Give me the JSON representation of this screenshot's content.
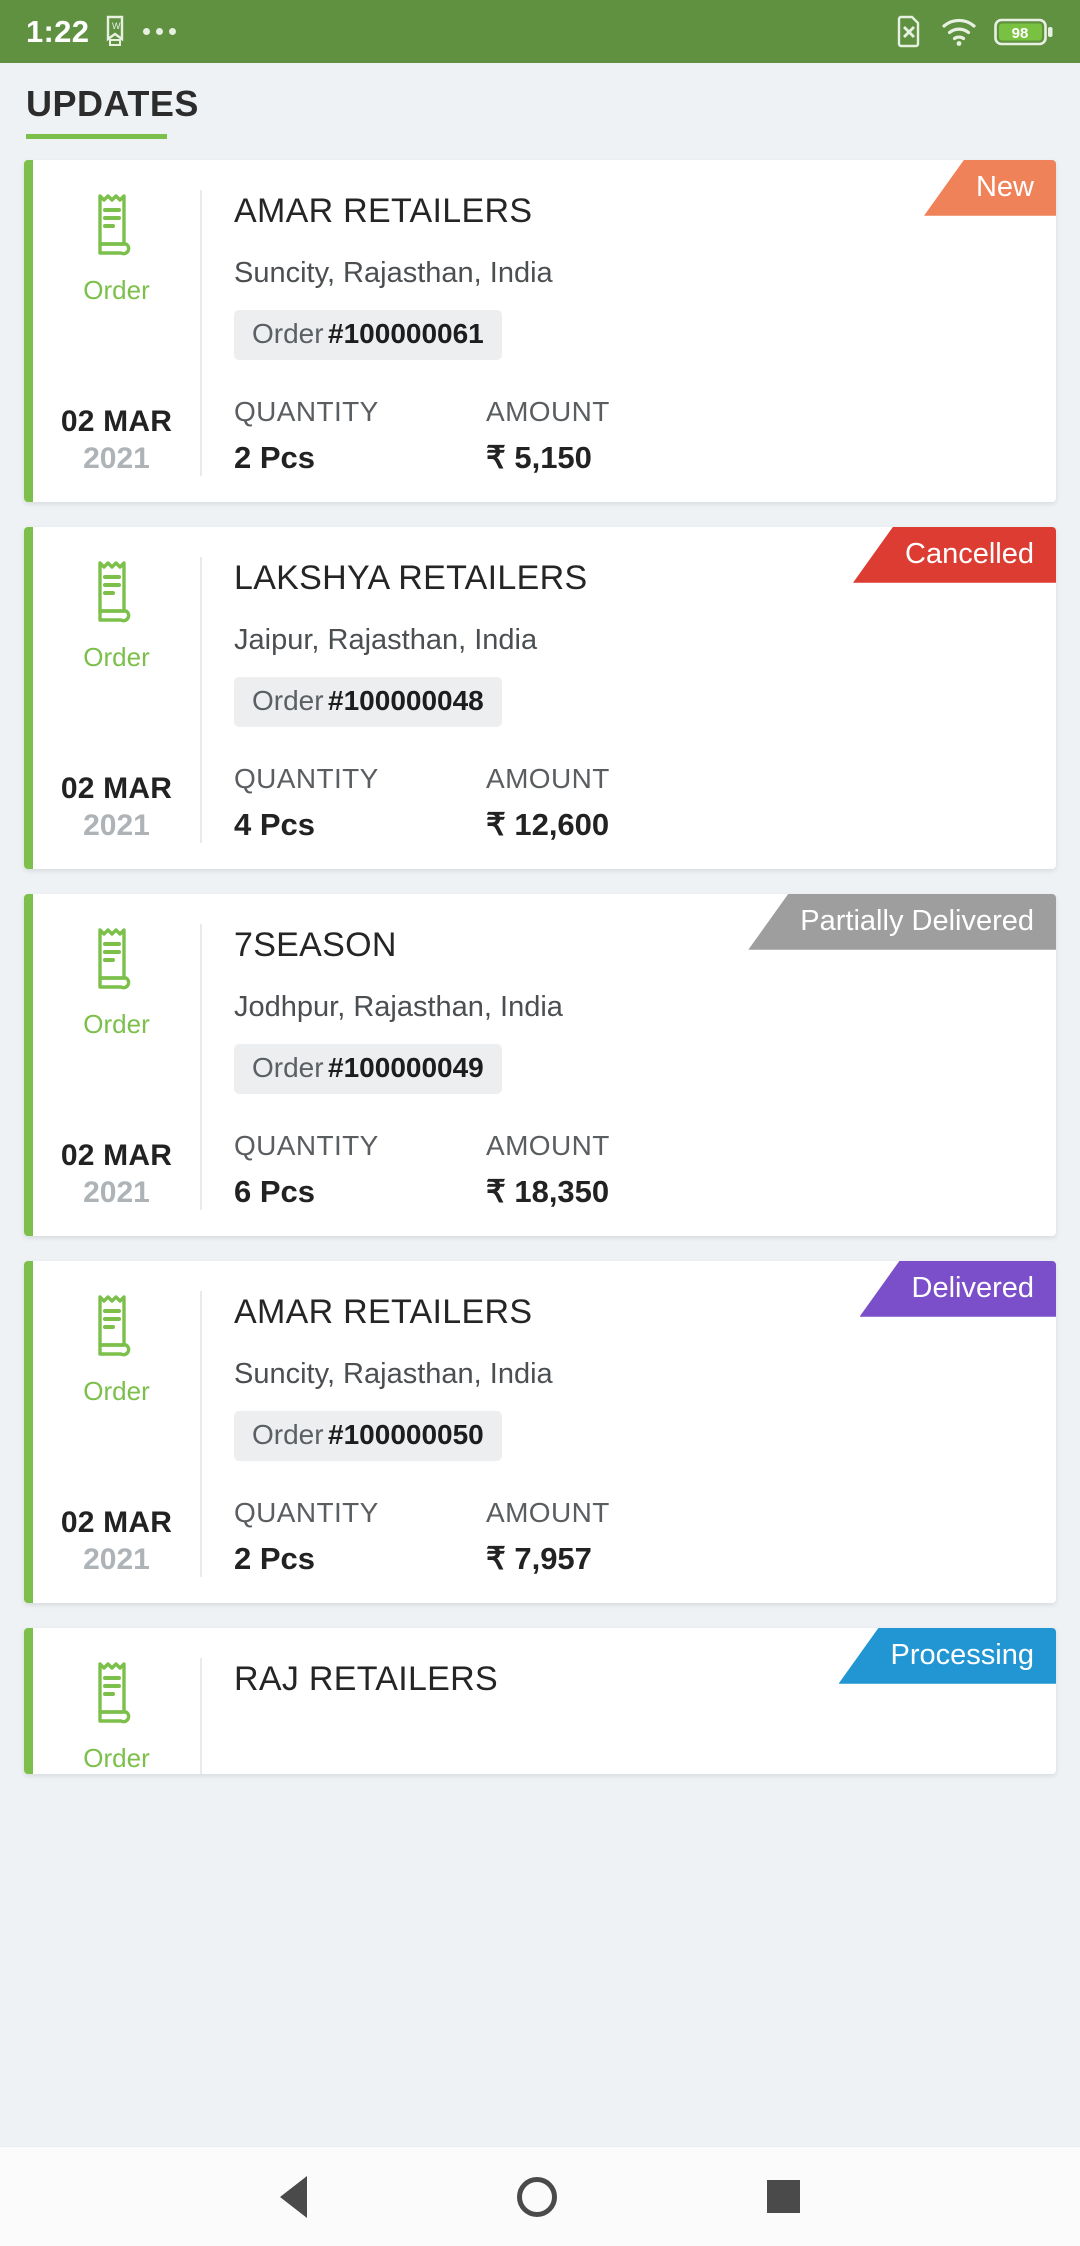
{
  "statusbar": {
    "time": "1:22",
    "icons": [
      "bookmark-icon",
      "overflow-dots-icon"
    ],
    "right_icons": [
      "no-sim-icon",
      "wifi-icon",
      "battery-icon"
    ],
    "battery_level": "98",
    "bg_color": "#5f9141"
  },
  "header": {
    "title": "UPDATES",
    "accent_color": "#7cc04b"
  },
  "labels": {
    "order_type": "Order",
    "order_prefix": "Order",
    "quantity_label": "QUANTITY",
    "amount_label": "AMOUNT"
  },
  "status_colors": {
    "new": "#f0825a",
    "cancelled": "#dc3c32",
    "partially_delivered": "#9e9e9e",
    "delivered": "#7b4fc9",
    "processing": "#2196d3"
  },
  "cards": [
    {
      "type": "Order",
      "shop": "AMAR RETAILERS",
      "address": "Suncity, Rajasthan, India",
      "order_prefix": "Order",
      "order_number": "#100000061",
      "date_day": "02 MAR",
      "date_year": "2021",
      "quantity_label": "QUANTITY",
      "quantity": "2 Pcs",
      "amount_label": "AMOUNT",
      "amount": "₹ 5,150",
      "status": "New",
      "status_color": "#f0825a"
    },
    {
      "type": "Order",
      "shop": "LAKSHYA RETAILERS",
      "address": "Jaipur, Rajasthan, India",
      "order_prefix": "Order",
      "order_number": "#100000048",
      "date_day": "02 MAR",
      "date_year": "2021",
      "quantity_label": "QUANTITY",
      "quantity": "4 Pcs",
      "amount_label": "AMOUNT",
      "amount": "₹ 12,600",
      "status": "Cancelled",
      "status_color": "#dc3c32"
    },
    {
      "type": "Order",
      "shop": "7SEASON",
      "address": "Jodhpur, Rajasthan, India",
      "order_prefix": "Order",
      "order_number": "#100000049",
      "date_day": "02 MAR",
      "date_year": "2021",
      "quantity_label": "QUANTITY",
      "quantity": "6 Pcs",
      "amount_label": "AMOUNT",
      "amount": "₹ 18,350",
      "status": "Partially Delivered",
      "status_color": "#9e9e9e"
    },
    {
      "type": "Order",
      "shop": "AMAR RETAILERS",
      "address": "Suncity, Rajasthan, India",
      "order_prefix": "Order",
      "order_number": "#100000050",
      "date_day": "02 MAR",
      "date_year": "2021",
      "quantity_label": "QUANTITY",
      "quantity": "2 Pcs",
      "amount_label": "AMOUNT",
      "amount": "₹ 7,957",
      "status": "Delivered",
      "status_color": "#7b4fc9"
    },
    {
      "type": "Order",
      "shop": "RAJ RETAILERS",
      "address": "",
      "order_prefix": "Order",
      "order_number": "",
      "date_day": "",
      "date_year": "",
      "quantity_label": "",
      "quantity": "",
      "amount_label": "",
      "amount": "",
      "status": "Processing",
      "status_color": "#2196d3"
    }
  ],
  "navbar": {
    "back": "back-button",
    "home": "home-button",
    "recents": "recents-button"
  }
}
